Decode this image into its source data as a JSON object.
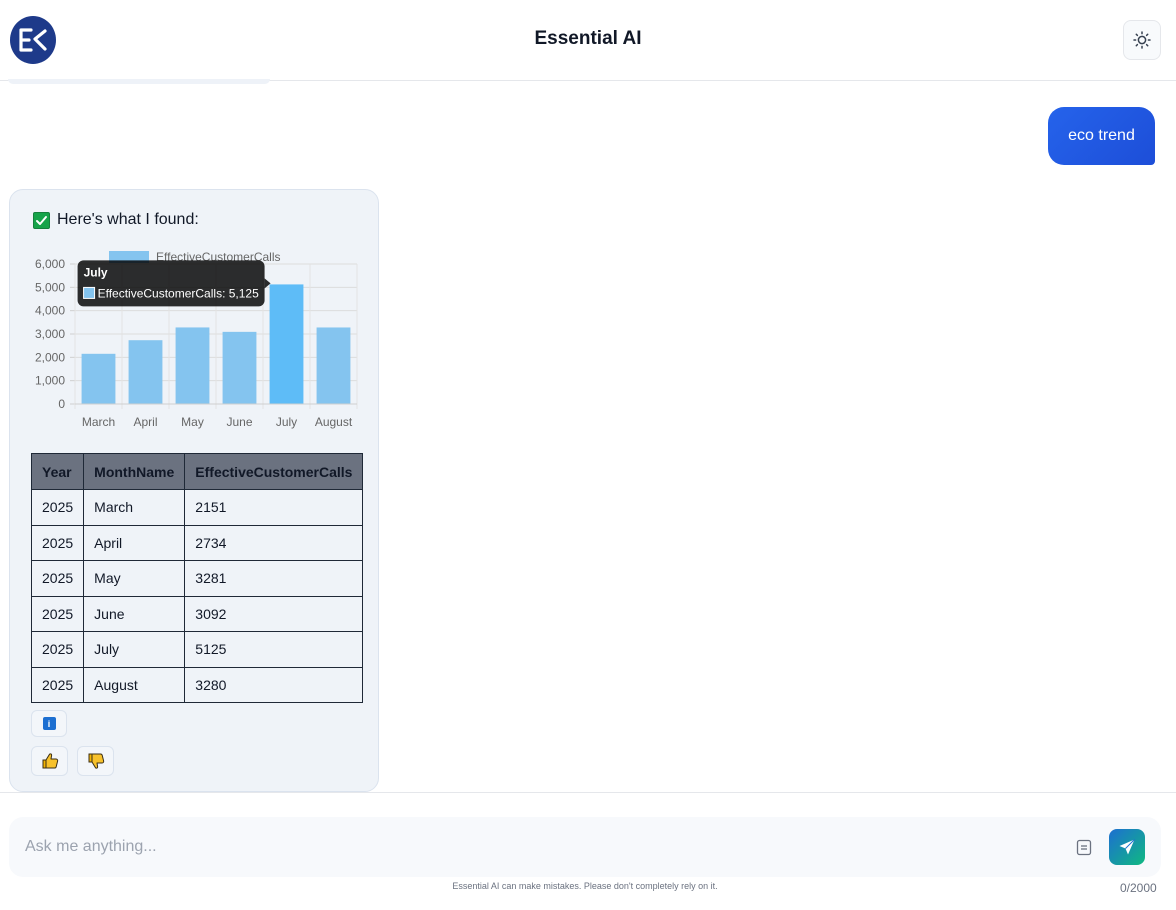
{
  "header": {
    "title": "Essential AI",
    "logo_text": "ES",
    "logo_icon": "es-logo-icon",
    "theme_icon": "sun-icon"
  },
  "conversation": {
    "user_message": "eco trend",
    "bot_intro": "Here's what I found:"
  },
  "chart_data": {
    "type": "bar",
    "categories": [
      "March",
      "April",
      "May",
      "June",
      "July",
      "August"
    ],
    "series": [
      {
        "name": "EffectiveCustomerCalls",
        "values": [
          2151,
          2734,
          3281,
          3092,
          5125,
          3280
        ],
        "color": "#84c4ef"
      }
    ],
    "ylim": [
      0,
      6000
    ],
    "yticks": [
      "0",
      "1,000",
      "2,000",
      "3,000",
      "4,000",
      "5,000",
      "6,000"
    ],
    "grid": true,
    "legend": "top",
    "highlight_color": "#5ebcf7",
    "tooltip": {
      "title": "July",
      "label": "EffectiveCustomerCalls: 5,125",
      "category_index": 4
    }
  },
  "table": {
    "headers": [
      "Year",
      "MonthName",
      "EffectiveCustomerCalls"
    ],
    "rows": [
      [
        "2025",
        "March",
        "2151"
      ],
      [
        "2025",
        "April",
        "2734"
      ],
      [
        "2025",
        "May",
        "3281"
      ],
      [
        "2025",
        "June",
        "3092"
      ],
      [
        "2025",
        "July",
        "5125"
      ],
      [
        "2025",
        "August",
        "3280"
      ]
    ]
  },
  "actions": {
    "info_icon": "info-icon",
    "info_glyph": "i",
    "thumbs_up_icon": "thumbs-up-icon",
    "thumbs_down_icon": "thumbs-down-icon"
  },
  "composer": {
    "placeholder": "Ask me anything...",
    "value": "",
    "char_count": "0/2000",
    "disclaimer": "Essential AI can make mistakes. Please don't completely rely on it."
  },
  "colors": {
    "accent": "#2563eb",
    "send_gradient": [
      "#1d6fd1",
      "#10b981"
    ],
    "table_header_bg": "#6b7280"
  }
}
